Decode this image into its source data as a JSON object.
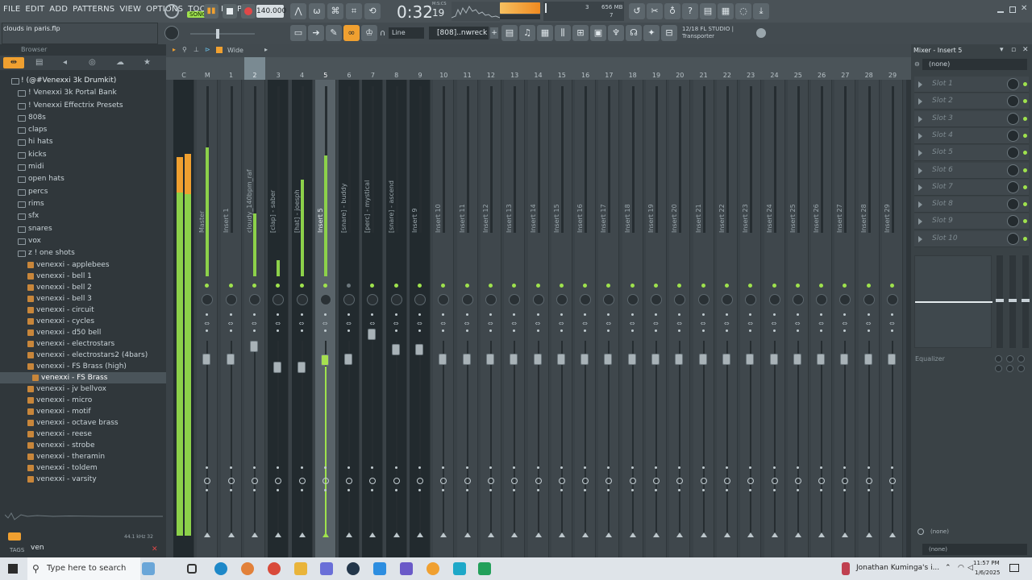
{
  "menu": [
    "FILE",
    "EDIT",
    "ADD",
    "PATTERNS",
    "VIEW",
    "OPTIONS",
    "TOOLS",
    "HELP"
  ],
  "transport": {
    "song_label": "SONG",
    "tempo": "140.000",
    "time": "0:32",
    "time_frac": "19",
    "time_unit": "M:S:CS",
    "mem": "656 MB",
    "cpu_a": "3",
    "cpu_b": "7"
  },
  "project_file": "clouds in paris.flp",
  "toolbar2": {
    "snap": "Line",
    "pattern": "[808]..nwreck",
    "hint_line1": "12/18  FL STUDIO |",
    "hint_line2": "Transporter"
  },
  "browser": {
    "title": "Browser",
    "root": "! (@#Venexxi 3k Drumkit)",
    "folders": [
      "! Venexxi 3k Portal Bank",
      "! Venexxi Effectrix Presets",
      "808s",
      "claps",
      "hi hats",
      "kicks",
      "midi",
      "open hats",
      "percs",
      "rims",
      "sfx",
      "snares",
      "vox",
      "z ! one shots"
    ],
    "files": [
      "venexxi - applebees",
      "venexxi - bell 1",
      "venexxi - bell 2",
      "venexxi - bell 3",
      "venexxi - circuit",
      "venexxi - cycles",
      "venexxi - d50 bell",
      "venexxi - electrostars",
      "venexxi - electrostars2 (4bars)",
      "venexxi - FS Brass (high)",
      "venexxi - FS Brass",
      "venexxi - jv bellvox",
      "venexxi - micro",
      "venexxi - motif",
      "venexxi - octave brass",
      "venexxi - reese",
      "venexxi - strobe",
      "venexxi - theramin",
      "venexxi - toldem",
      "venexxi - varsity"
    ],
    "selected_file": "venexxi - FS Brass",
    "sample_rate": "44.1 kHz 32",
    "tags_label": "TAGS",
    "search_value": "ven"
  },
  "mixer": {
    "view_label": "Wide",
    "tracks": [
      {
        "num": "C",
        "name": ""
      },
      {
        "num": "M",
        "name": "Master"
      },
      {
        "num": "1",
        "name": "Insert 1"
      },
      {
        "num": "2",
        "name": "cloudy_140bpm_raf"
      },
      {
        "num": "3",
        "name": "[clap] - saber"
      },
      {
        "num": "4",
        "name": "[hat] - joesph"
      },
      {
        "num": "5",
        "name": "Insert 5"
      },
      {
        "num": "6",
        "name": "[snare] - buddy"
      },
      {
        "num": "7",
        "name": "[perc] - mystical"
      },
      {
        "num": "8",
        "name": "[snare] - ascend"
      },
      {
        "num": "9",
        "name": "Insert 9"
      },
      {
        "num": "10",
        "name": "Insert 10"
      },
      {
        "num": "11",
        "name": "Insert 11"
      },
      {
        "num": "12",
        "name": "Insert 12"
      },
      {
        "num": "13",
        "name": "Insert 13"
      },
      {
        "num": "14",
        "name": "Insert 14"
      },
      {
        "num": "15",
        "name": "Insert 15"
      },
      {
        "num": "16",
        "name": "Insert 16"
      },
      {
        "num": "17",
        "name": "Insert 17"
      },
      {
        "num": "18",
        "name": "Insert 18"
      },
      {
        "num": "19",
        "name": "Insert 19"
      },
      {
        "num": "20",
        "name": "Insert 20"
      },
      {
        "num": "21",
        "name": "Insert 21"
      },
      {
        "num": "22",
        "name": "Insert 22"
      },
      {
        "num": "23",
        "name": "Insert 23"
      },
      {
        "num": "24",
        "name": "Insert 24"
      },
      {
        "num": "25",
        "name": "Insert 25"
      },
      {
        "num": "26",
        "name": "Insert 26"
      },
      {
        "num": "27",
        "name": "Insert 27"
      },
      {
        "num": "28",
        "name": "Insert 28"
      },
      {
        "num": "29",
        "name": "Insert 29"
      }
    ]
  },
  "insert_panel": {
    "title": "Mixer - Insert 5",
    "input": "(none)",
    "slots": [
      "Slot 1",
      "Slot 2",
      "Slot 3",
      "Slot 4",
      "Slot 5",
      "Slot 6",
      "Slot 7",
      "Slot 8",
      "Slot 9",
      "Slot 10"
    ],
    "eq_label": "Equalizer",
    "output_1": "(none)",
    "output_2": "(none)"
  },
  "taskbar": {
    "search_placeholder": "Type here to search",
    "media": "Jonathan Kuminga's i...",
    "time": "11:57 PM",
    "date": "1/6/2025"
  },
  "colors": {
    "accent_green": "#9fe24d",
    "accent_orange": "#f0a030",
    "record_red": "#e04848"
  }
}
